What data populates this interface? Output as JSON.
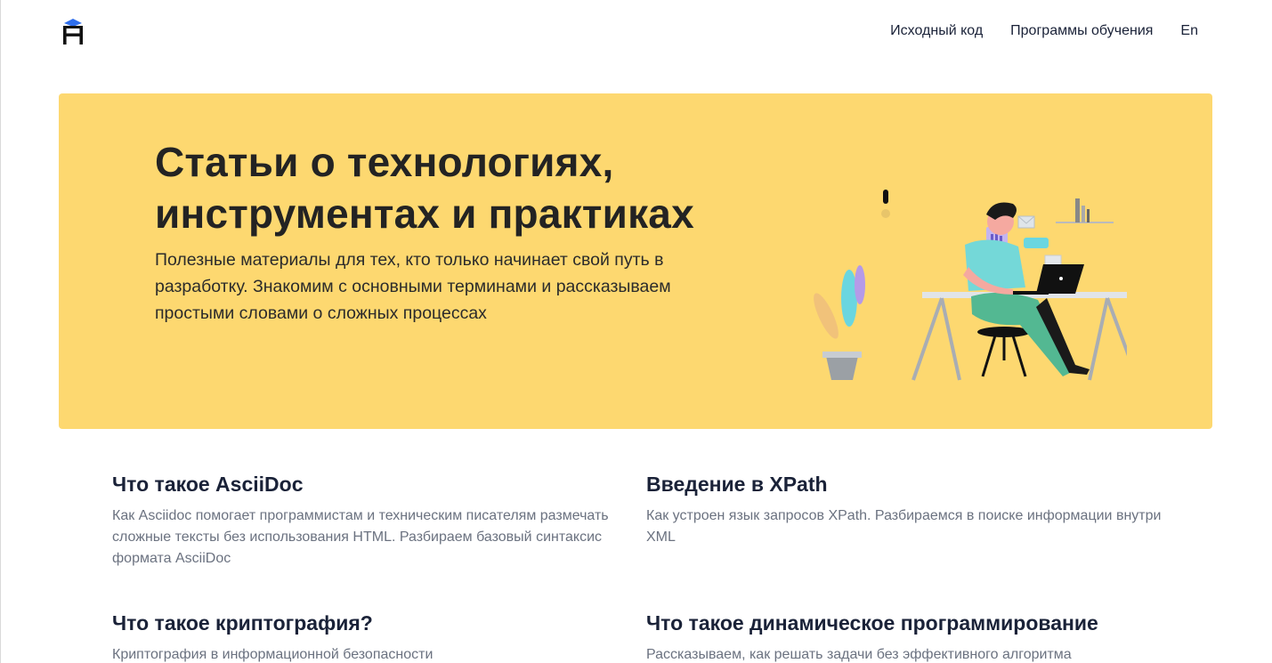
{
  "header": {
    "logo_letter": "H",
    "nav": [
      {
        "label": "Исходный код"
      },
      {
        "label": "Программы обучения"
      },
      {
        "label": "En"
      }
    ]
  },
  "hero": {
    "title": "Статьи о технологиях, инструментах и практиках",
    "subtitle": "Полезные материалы для тех, кто только начинает свой путь в разработку. Знакомим с основными терминами и рассказываем простыми словами о сложных процессах",
    "background_color": "#fdd870"
  },
  "articles": [
    {
      "title": "Что такое AsciiDoc",
      "description": "Как Asciidoc помогает программистам и техническим писателям размечать сложные тексты без использования HTML. Разбираем базовый синтаксис формата AsciiDoc"
    },
    {
      "title": "Введение в XPath",
      "description": "Как устроен язык запросов XPath. Разбираемся в поиске информации внутри XML"
    },
    {
      "title": "Что такое криптография?",
      "description": "Криптография в информационной безопасности"
    },
    {
      "title": "Что такое динамическое программирование",
      "description": "Рассказываем, как решать задачи без эффективного алгоритма"
    }
  ],
  "colors": {
    "logo_accent": "#2f6fed",
    "title_text": "#1a2238",
    "muted_text": "#6b7280"
  }
}
